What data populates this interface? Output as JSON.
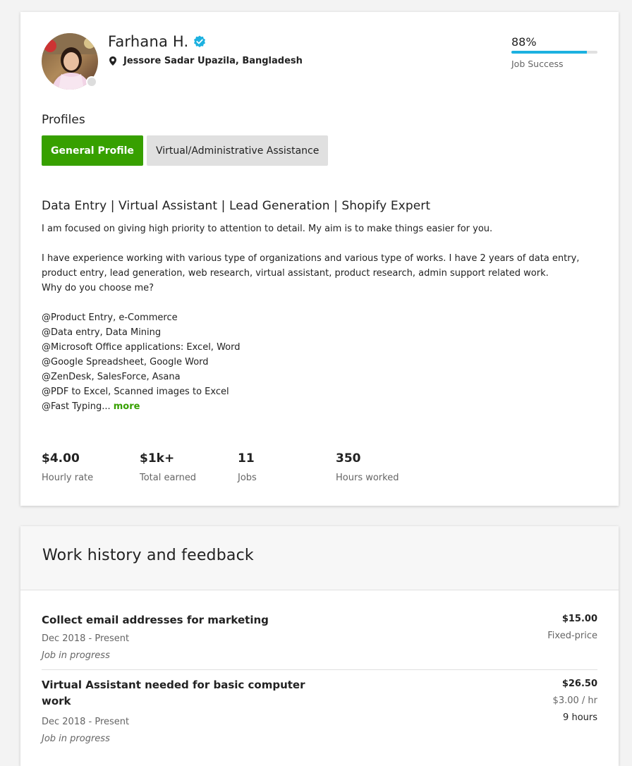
{
  "profile": {
    "name": "Farhana H.",
    "location": "Jessore Sadar Upazila, Bangladesh",
    "job_success": {
      "value": "88%",
      "label": "Job Success",
      "percent": 88
    },
    "profiles_title": "Profiles",
    "tabs": [
      {
        "label": "General Profile",
        "active": true
      },
      {
        "label": "Virtual/Administrative Assistance",
        "active": false
      }
    ],
    "headline": "Data Entry | Virtual Assistant | Lead Generation | Shopify Expert",
    "overview": "I am focused on giving high priority to attention to detail. My aim is to make things easier for you.\n\nI have experience working with various type of organizations and various type of works. I have 2 years of data entry, product entry, lead generation, web research, virtual assistant, product research, admin support related work.\nWhy do you choose me?\n\n@Product Entry, e-Commerce\n@Data entry, Data Mining\n@Microsoft Office applications: Excel, Word\n@Google Spreadsheet, Google Word\n@ZenDesk, SalesForce, Asana\n@PDF to Excel, Scanned images to Excel\n@Fast Typing... ",
    "more_label": "more",
    "stats": [
      {
        "value": "$4.00",
        "label": "Hourly rate"
      },
      {
        "value": "$1k+",
        "label": "Total earned"
      },
      {
        "value": "11",
        "label": "Jobs"
      },
      {
        "value": "350",
        "label": "Hours worked"
      }
    ],
    "icons": {
      "verified": "verified-badge-icon",
      "location": "map-pin-icon"
    },
    "colors": {
      "accent": "#37a000",
      "jss_bar": "#1cb1e0",
      "verified": "#1cb1e0"
    }
  },
  "history": {
    "title": "Work history and feedback",
    "jobs": [
      {
        "title": "Collect email addresses for marketing",
        "dates": "Dec 2018 - Present",
        "status": "Job in progress",
        "amount": "$15.00",
        "type": "Fixed-price",
        "hours": ""
      },
      {
        "title": "Virtual Assistant needed for basic computer work",
        "dates": "Dec 2018 - Present",
        "status": "Job in progress",
        "amount": "$26.50",
        "type": "$3.00 / hr",
        "hours": "9 hours"
      }
    ]
  }
}
